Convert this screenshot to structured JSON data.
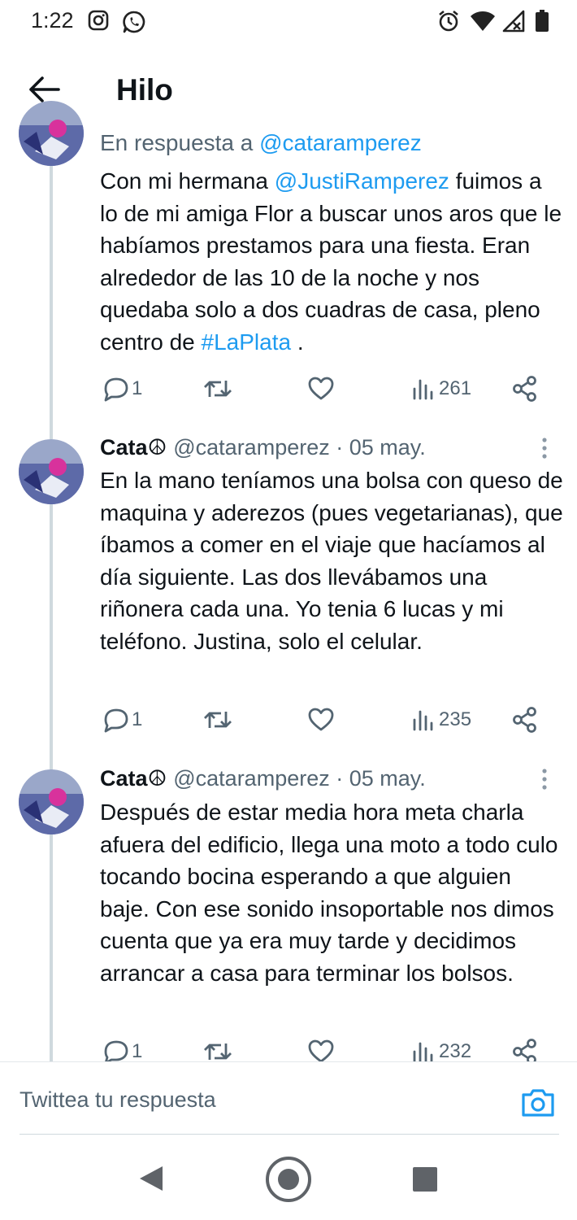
{
  "status_bar": {
    "time": "1:22",
    "left_icons": [
      "instagram-icon",
      "whatsapp-icon"
    ],
    "right_icons": [
      "alarm-icon",
      "wifi-icon",
      "signal-icon",
      "battery-icon"
    ]
  },
  "header": {
    "back_icon": "arrow-left-icon",
    "title": "Hilo"
  },
  "tweets": [
    {
      "reply_context": {
        "prefix": "En respuesta a",
        "handle": "@cataramperez"
      },
      "text": [
        {
          "t": "Con mi hermana "
        },
        {
          "t": "@JustiRamperez",
          "link": true
        },
        {
          "t": " fuimos a lo de mi amiga Flor a buscar unos aros que le habíamos prestamos para una fiesta. Eran alrededor de las 10 de la noche y nos quedaba solo a dos cuadras de casa, pleno centro de "
        },
        {
          "t": "#LaPlata",
          "link": true
        },
        {
          "t": " ."
        }
      ],
      "replies": "1",
      "views": "261"
    },
    {
      "name": "Cata☮",
      "handle": "@cataramperez",
      "date": "· 05 may.",
      "text": [
        {
          "t": "En la mano teníamos una bolsa con queso de maquina y aderezos (pues vegetarianas), que íbamos a comer en el viaje que hacíamos al día siguiente. Las dos llevábamos una riñonera cada una. Yo tenia 6 lucas y mi teléfono. Justina, solo el celular."
        }
      ],
      "replies": "1",
      "views": "235"
    },
    {
      "name": "Cata☮",
      "handle": "@cataramperez",
      "date": "· 05 may.",
      "text": [
        {
          "t": "Después de estar media hora meta charla afuera del edificio, llega una moto a todo culo tocando bocina esperando a que alguien baje. Con ese sonido insoportable nos dimos cuenta que ya era muy tarde y decidimos arrancar a casa para terminar los bolsos."
        }
      ],
      "replies": "1",
      "views": "232"
    }
  ],
  "reply_bar": {
    "placeholder": "Twittea tu respuesta",
    "camera_icon": "camera-icon"
  },
  "nav_bar": {
    "icons": [
      "back-triangle-icon",
      "home-circle-icon",
      "recents-square-icon"
    ]
  },
  "colors": {
    "link": "#1d9bf0",
    "secondary_text": "#536471",
    "primary_text": "#0f1419",
    "thread_line": "#cfd9de"
  }
}
